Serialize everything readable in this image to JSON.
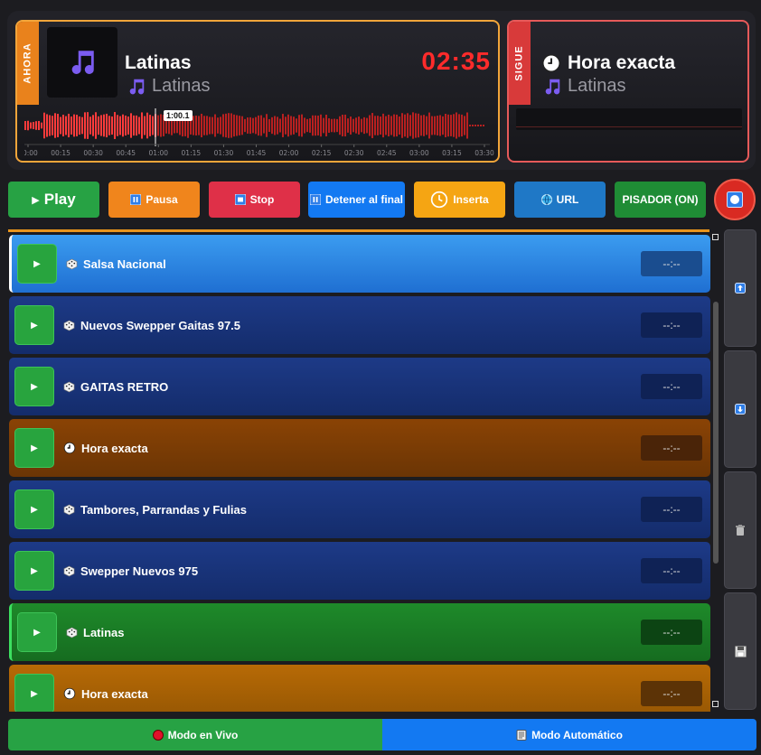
{
  "now_playing": {
    "tag": "AHORA",
    "title": "Latinas",
    "artist": "Latinas",
    "timer": "02:35",
    "position_marker": "1:00.1",
    "time_ticks": [
      "00:00",
      "00:15",
      "00:30",
      "00:45",
      "01:00",
      "01:15",
      "01:30",
      "01:45",
      "02:00",
      "02:15",
      "02:30",
      "02:45",
      "03:00",
      "03:15",
      "03:30"
    ]
  },
  "next_up": {
    "tag": "SIGUE",
    "title": "Hora exacta",
    "artist": "Latinas"
  },
  "controls": {
    "play": "Play",
    "pausa": "Pausa",
    "stop": "Stop",
    "detener": "Detener al final",
    "inserta": "Inserta",
    "url": "URL",
    "pisador": "PISADOR (ON)"
  },
  "playlist": [
    {
      "name": "Salsa Nacional",
      "icon": "dice-icon",
      "duration": "--:--",
      "style": "selected"
    },
    {
      "name": "Nuevos Swepper Gaitas 97.5",
      "icon": "dice-icon",
      "duration": "--:--",
      "style": "blue"
    },
    {
      "name": "GAITAS RETRO",
      "icon": "dice-icon",
      "duration": "--:--",
      "style": "blue"
    },
    {
      "name": "Hora exacta",
      "icon": "clock-icon",
      "duration": "--:--",
      "style": "brown"
    },
    {
      "name": "Tambores, Parrandas y Fulias",
      "icon": "dice-icon",
      "duration": "--:--",
      "style": "blue"
    },
    {
      "name": "Swepper Nuevos 975",
      "icon": "dice-icon",
      "duration": "--:--",
      "style": "blue"
    },
    {
      "name": "Latinas",
      "icon": "dice-icon",
      "duration": "--:--",
      "style": "green"
    },
    {
      "name": "Hora exacta",
      "icon": "clock-icon",
      "duration": "--:--",
      "style": "orange"
    }
  ],
  "modes": {
    "live": "Modo en Vivo",
    "auto": "Modo Automático"
  },
  "colors": {
    "now_border": "#f2a53a",
    "next_border": "#e65a5a",
    "timer": "#ff2b2b",
    "waveform": "#e52a2a"
  }
}
